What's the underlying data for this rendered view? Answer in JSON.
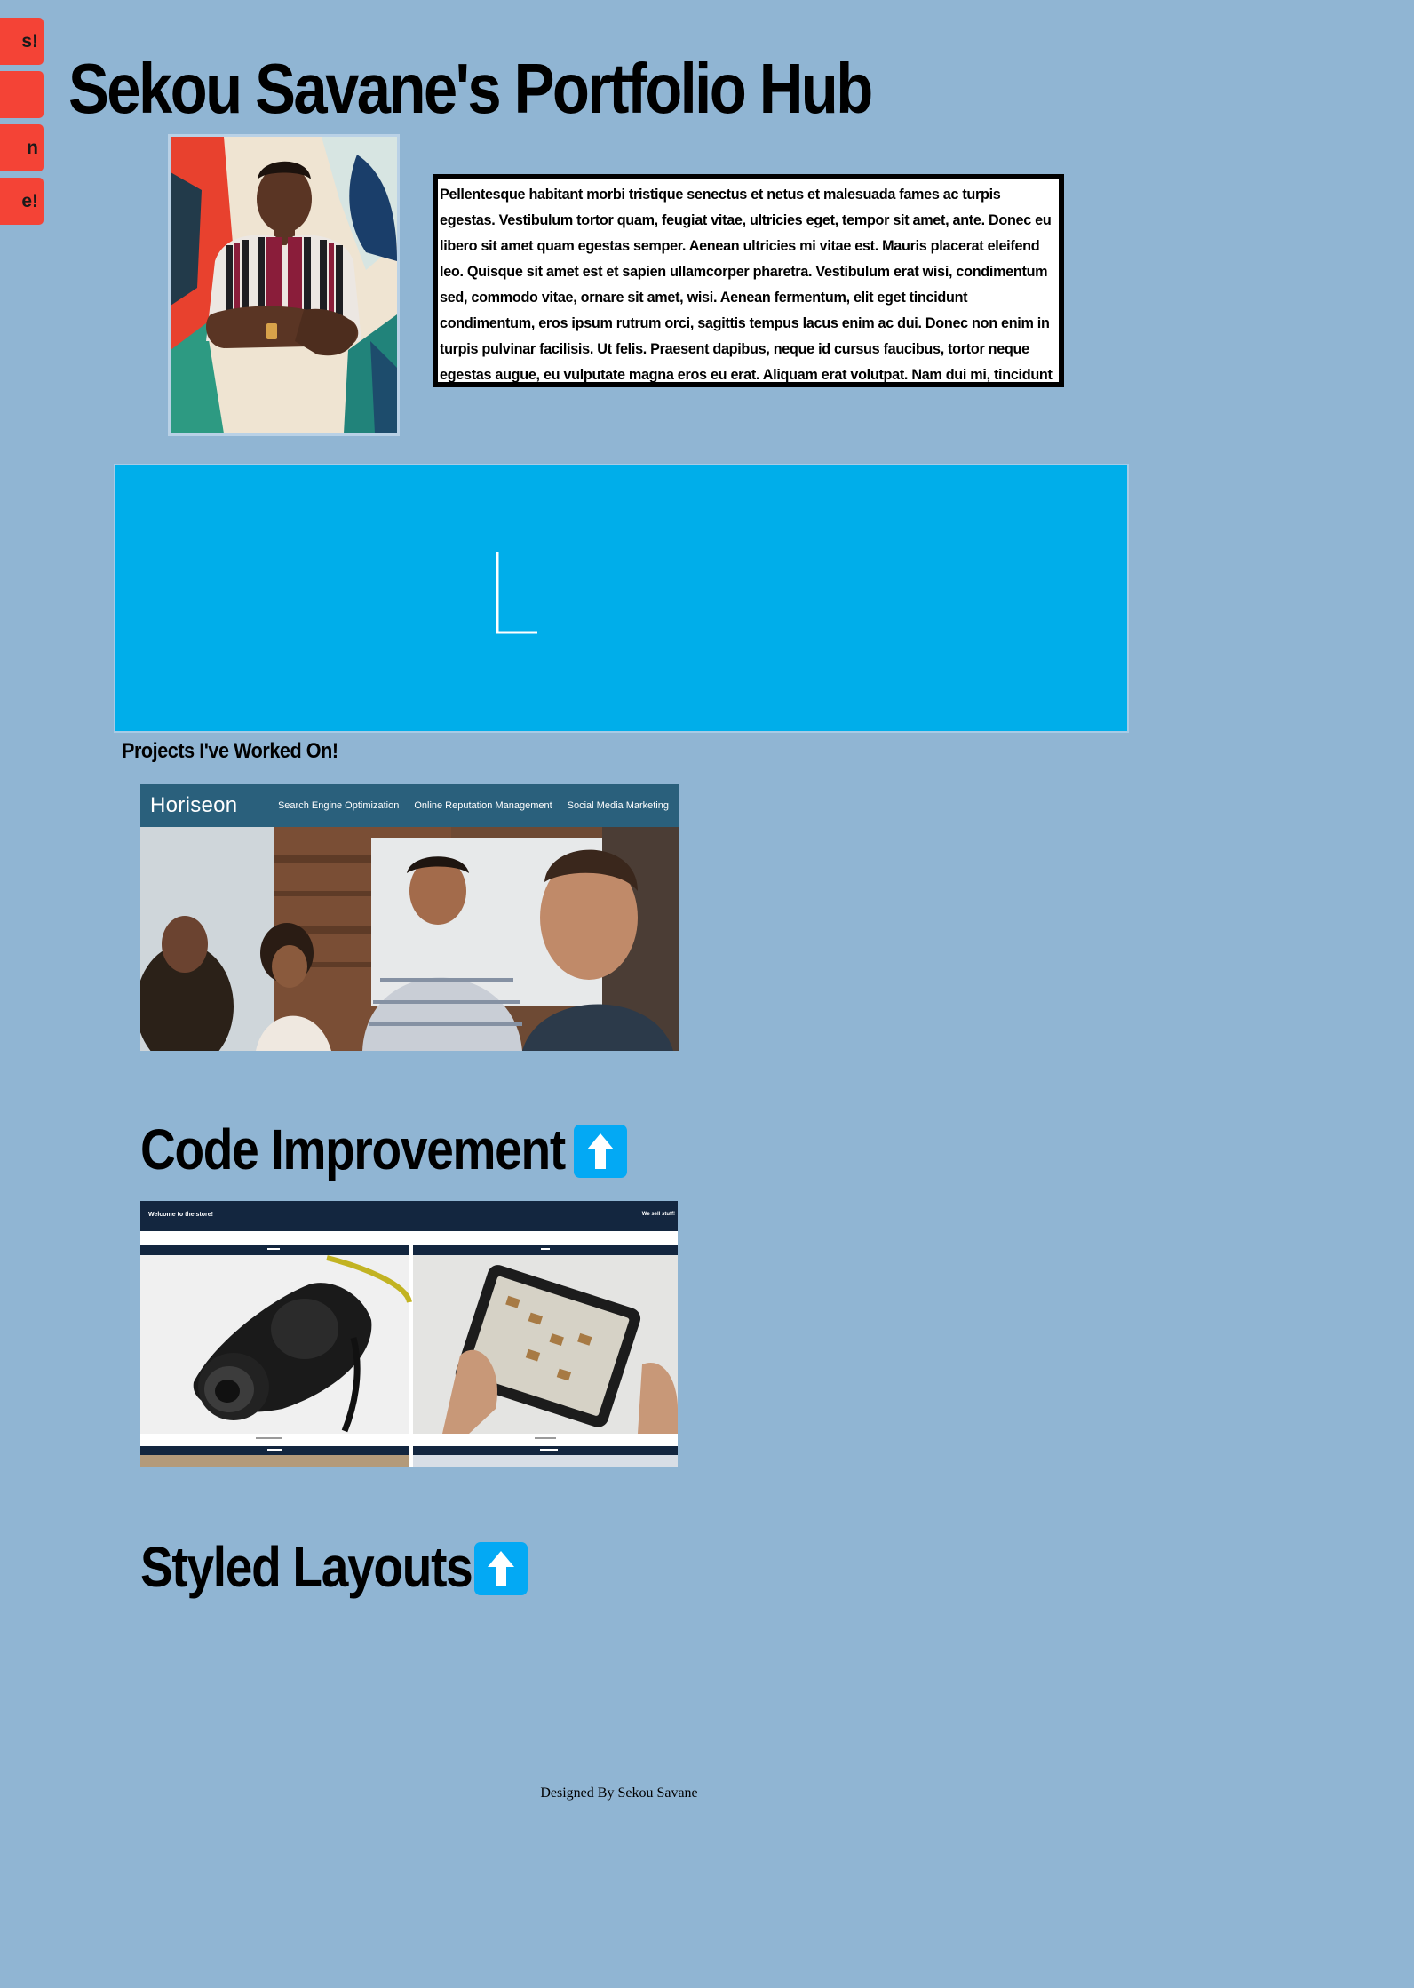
{
  "nav": {
    "items": [
      {
        "label": "s!"
      },
      {
        "label": ""
      },
      {
        "label": "n"
      },
      {
        "label": "e!"
      }
    ],
    "color": "#f44336"
  },
  "header": {
    "title": "Sekou Savane's Portfolio Hub"
  },
  "bio": {
    "text": "Pellentesque habitant morbi tristique senectus et netus et malesuada fames ac turpis egestas. Vestibulum tortor quam, feugiat vitae, ultricies eget, tempor sit amet, ante. Donec eu libero sit amet quam egestas semper. Aenean ultricies mi vitae est. Mauris placerat eleifend leo. Quisque sit amet est et sapien ullamcorper pharetra. Vestibulum erat wisi, condimentum sed, commodo vitae, ornare sit amet, wisi. Aenean fermentum, elit eget tincidunt condimentum, eros ipsum rutrum orci, sagittis tempus lacus enim ac dui. Donec non enim in turpis pulvinar facilisis. Ut felis. Praesent dapibus, neque id cursus faucibus, tortor neque egestas augue, eu vulputate magna eros eu erat. Aliquam erat volutpat. Nam dui mi, tincidunt quis, accumsan porttitor, facilisis luctus, metus"
  },
  "projects": {
    "heading": "Projects I've Worked On!",
    "horiseon": {
      "brand": "Horiseon",
      "links": [
        "Search Engine Optimization",
        "Online Reputation Management",
        "Social Media Marketing"
      ]
    },
    "code_improvement": {
      "heading": "Code Improvement",
      "store_title": "Welcome to the store!",
      "store_right": "We sell stuff!"
    },
    "styled_layouts": {
      "heading": "Styled Layouts"
    }
  },
  "footer": {
    "credit": "Designed By Sekou Savane"
  },
  "colors": {
    "background": "#90b5d3",
    "accent": "#03a9f4",
    "banner": "#00aeea"
  },
  "icons": {
    "up_button": "arrow-up-icon"
  }
}
